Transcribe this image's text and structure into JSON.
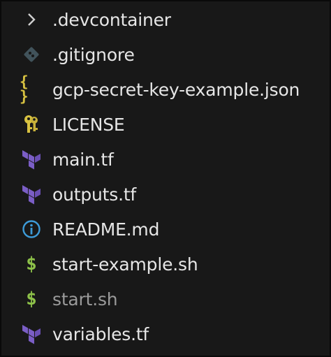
{
  "explorer": {
    "items": [
      {
        "label": ".devcontainer",
        "icon": "chevron-right-icon",
        "kind": "folder",
        "dimmed": false
      },
      {
        "label": ".gitignore",
        "icon": "git-icon",
        "kind": "file",
        "dimmed": false
      },
      {
        "label": "gcp-secret-key-example.json",
        "icon": "json-braces-icon",
        "kind": "file",
        "dimmed": false
      },
      {
        "label": "LICENSE",
        "icon": "license-keys-icon",
        "kind": "file",
        "dimmed": false
      },
      {
        "label": "main.tf",
        "icon": "terraform-icon",
        "kind": "file",
        "dimmed": false
      },
      {
        "label": "outputs.tf",
        "icon": "terraform-icon",
        "kind": "file",
        "dimmed": false
      },
      {
        "label": "README.md",
        "icon": "info-icon",
        "kind": "file",
        "dimmed": false
      },
      {
        "label": "start-example.sh",
        "icon": "dollar-shell-icon",
        "kind": "file",
        "dimmed": false
      },
      {
        "label": "start.sh",
        "icon": "dollar-shell-icon",
        "kind": "file",
        "dimmed": true
      },
      {
        "label": "variables.tf",
        "icon": "terraform-icon",
        "kind": "file",
        "dimmed": false
      }
    ],
    "glyphs": {
      "json": "{ }",
      "dollar": "$"
    },
    "colors": {
      "background": "#181818",
      "text": "#e6e6e6",
      "dimmed_text": "#9a9a9a",
      "terraform": "#7b5ec6",
      "json": "#d8c241",
      "shell": "#8dc149",
      "info": "#3d9bd8",
      "git": "#41535b",
      "license": "#d8c241"
    }
  }
}
